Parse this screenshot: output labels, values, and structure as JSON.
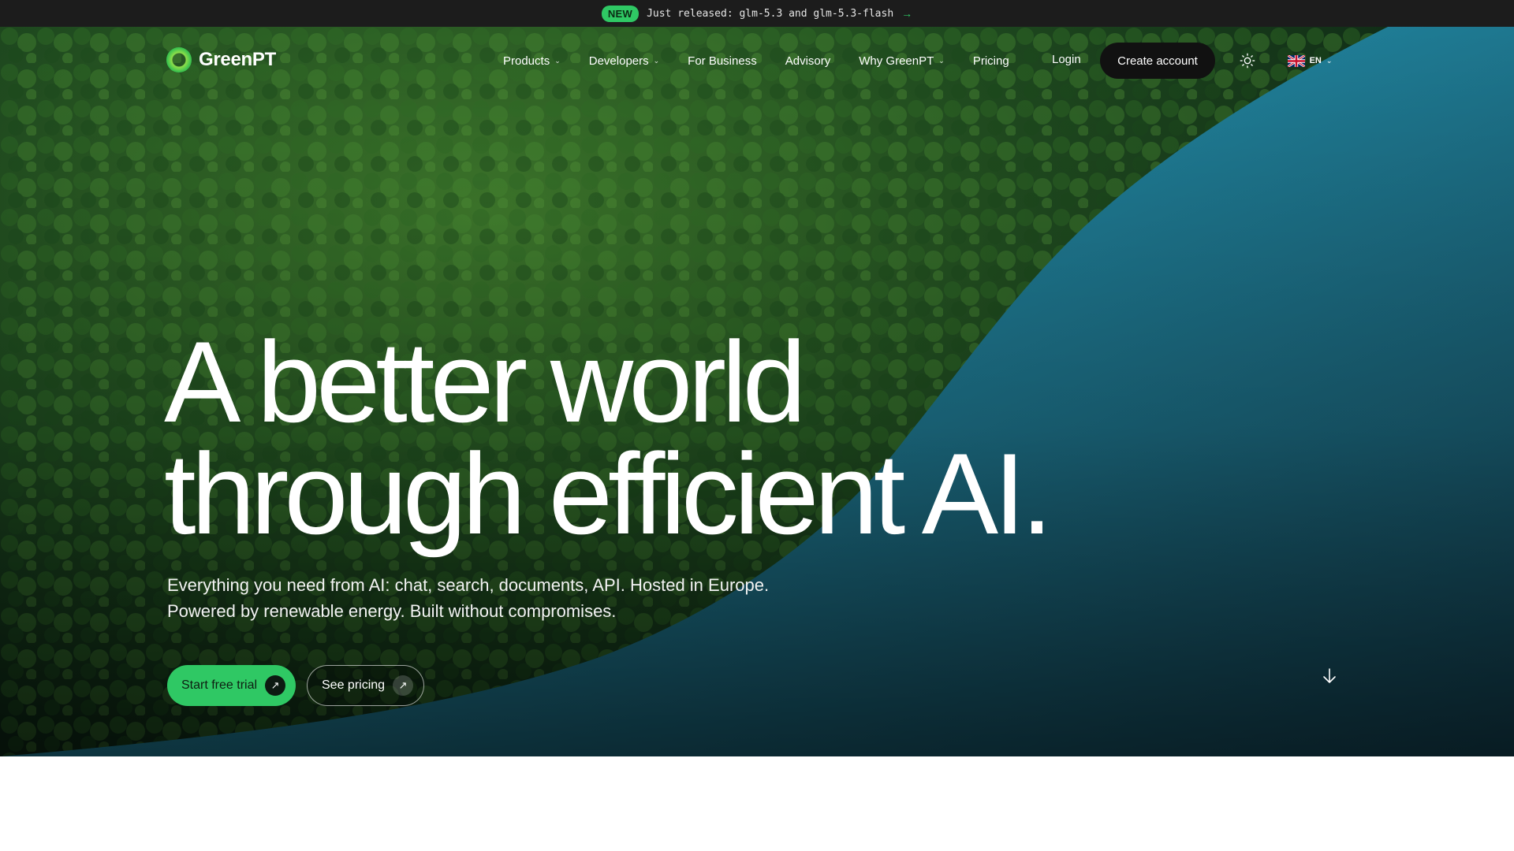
{
  "announcement": {
    "badge": "NEW",
    "text": "Just released: glm-5.3 and glm-5.3-flash",
    "arrow_icon": "arrow-right-icon"
  },
  "brand": {
    "name": "GreenPT",
    "accent_color": "#2fc864"
  },
  "nav": {
    "items": [
      {
        "label": "Products",
        "has_dropdown": true
      },
      {
        "label": "Developers",
        "has_dropdown": true
      },
      {
        "label": "For Business",
        "has_dropdown": false
      },
      {
        "label": "Advisory",
        "has_dropdown": false
      },
      {
        "label": "Why GreenPT",
        "has_dropdown": true
      },
      {
        "label": "Pricing",
        "has_dropdown": false
      }
    ],
    "login": "Login",
    "create_account": "Create account",
    "theme_icon": "sun-icon",
    "language": "EN",
    "language_flag_icon": "uk-flag-icon"
  },
  "hero": {
    "headline_line1": "A better world",
    "headline_line2": "through efficient AI.",
    "subtext_line1": "Everything you need from AI: chat, search, documents, API. Hosted in Europe.",
    "subtext_line2": "Powered by renewable energy. Built without compromises.",
    "primary_cta": "Start free trial",
    "secondary_cta": "See pricing",
    "scroll_icon": "arrow-down-icon"
  }
}
